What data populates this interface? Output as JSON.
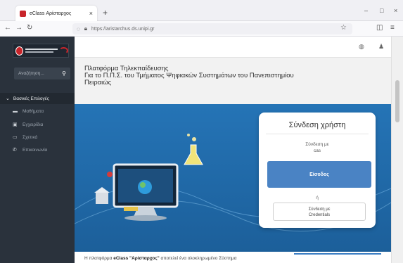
{
  "browser": {
    "tab_title": "eClass Αρίσταρχος",
    "tab_close": "×",
    "new_tab": "+",
    "url": "https://aristarchus.ds.unipi.gr",
    "window_controls": [
      "–",
      "□",
      "×"
    ]
  },
  "sidebar": {
    "search_placeholder": "Αναζήτηση...",
    "menu_header": "Βασικές Επιλογές",
    "items": [
      {
        "label": "Μαθήματα",
        "icon": "graduation-cap-icon"
      },
      {
        "label": "Εγχειρίδια",
        "icon": "book-icon"
      },
      {
        "label": "Σχετικά",
        "icon": "id-card-icon"
      },
      {
        "label": "Επικοινωνία",
        "icon": "phone-icon"
      }
    ]
  },
  "main": {
    "title_line1": "Πλατφόρμα Τηλεκπαίδευσης",
    "title_line2": "Για το Π.Π.Σ. του Τμήματος Ψηφιακών Συστημάτων του Πανεπιστημίου",
    "title_line3": "Πειραιώς",
    "intro_pre": "Η πλατφόρμα ",
    "intro_bold": "eClass \"Αρίσταρχος\"",
    "intro_post": " αποτελεί ένα ολοκληρωμένο Σύστημα"
  },
  "login": {
    "heading": "Σύνδεση χρήστη",
    "cas_label_1": "Σύνδεση με",
    "cas_label_2": "cas",
    "enter_button": "Είσοδος",
    "separator": "ή",
    "credentials_line1": "Σύνδεση με",
    "credentials_line2": "Credentials"
  },
  "colors": {
    "sidebar_bg": "#2a323c",
    "hero_bg": "#226aa8",
    "accent_button": "#4a83c4",
    "brand_red": "#c8252b"
  }
}
